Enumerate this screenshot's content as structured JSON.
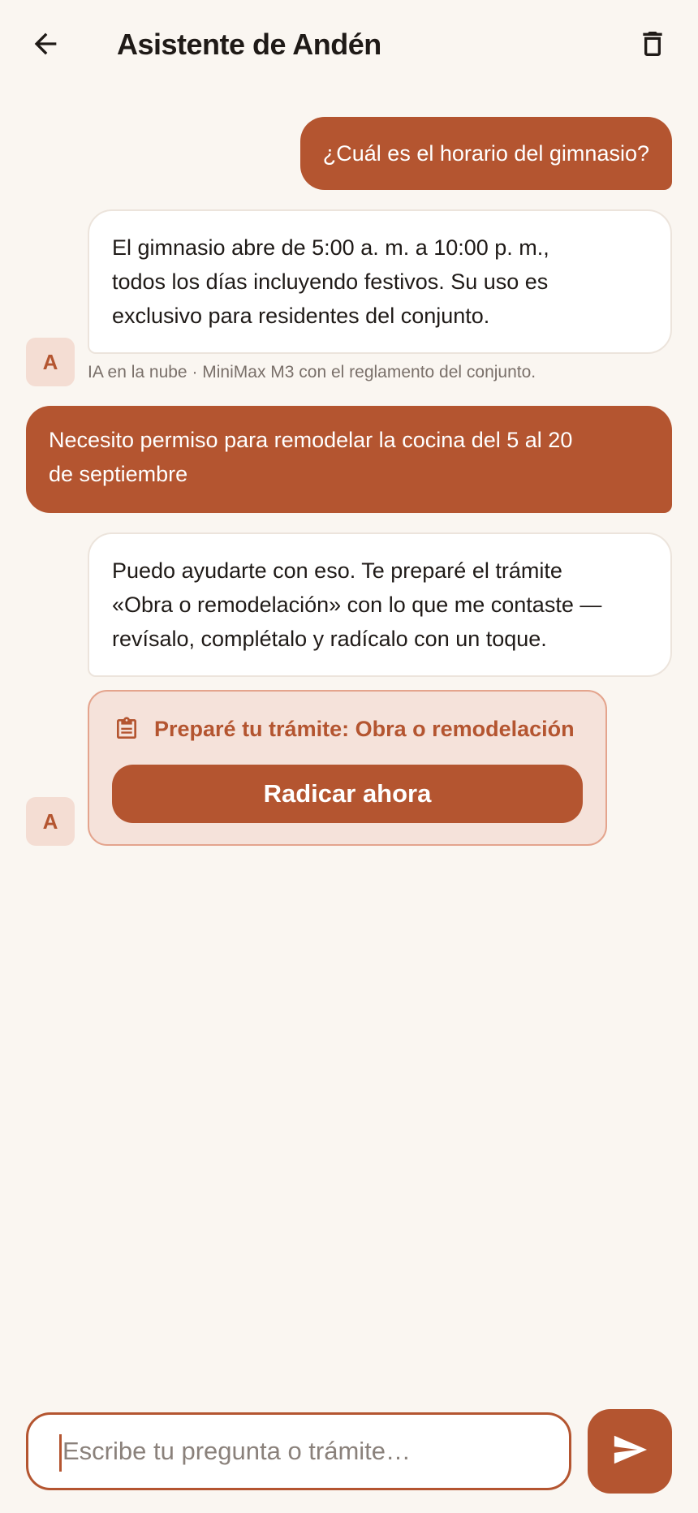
{
  "header": {
    "title": "Asistente de Andén",
    "back_icon": "arrow-left-icon",
    "delete_icon": "trash-icon"
  },
  "messages": [
    {
      "role": "user",
      "text": "¿Cuál es el horario del gimnasio?"
    },
    {
      "role": "assistant",
      "lines": [
        "El gimnasio abre de 5:00 a. m. a 10:00 p. m.,",
        "todos los días incluyendo festivos. Su uso es",
        "exclusivo para residentes del conjunto."
      ],
      "avatar": "A",
      "caption": "IA en la nube · MiniMax M3 con el reglamento del conjunto."
    },
    {
      "role": "user",
      "lines": [
        "Necesito permiso para remodelar la cocina del 5 al 20",
        "de septiembre"
      ]
    },
    {
      "role": "assistant",
      "lines": [
        "Puedo ayudarte con eso. Te preparé el trámite",
        "«Obra o remodelación» con lo que me contaste —",
        "revísalo, complétalo y radícalo con un toque."
      ],
      "avatar": "A"
    }
  ],
  "tramite_card": {
    "icon": "clipboard-icon",
    "title": "Preparé tu trámite: Obra o remodelación",
    "button_label": "Radicar ahora"
  },
  "composer": {
    "placeholder": "Escribe tu pregunta o trámite…",
    "value": "",
    "send_icon": "send-icon"
  },
  "colors": {
    "accent": "#B45530",
    "background": "#FAF6F1",
    "card_bg": "#F5E2DA",
    "avatar_bg": "#F4DDD3"
  }
}
